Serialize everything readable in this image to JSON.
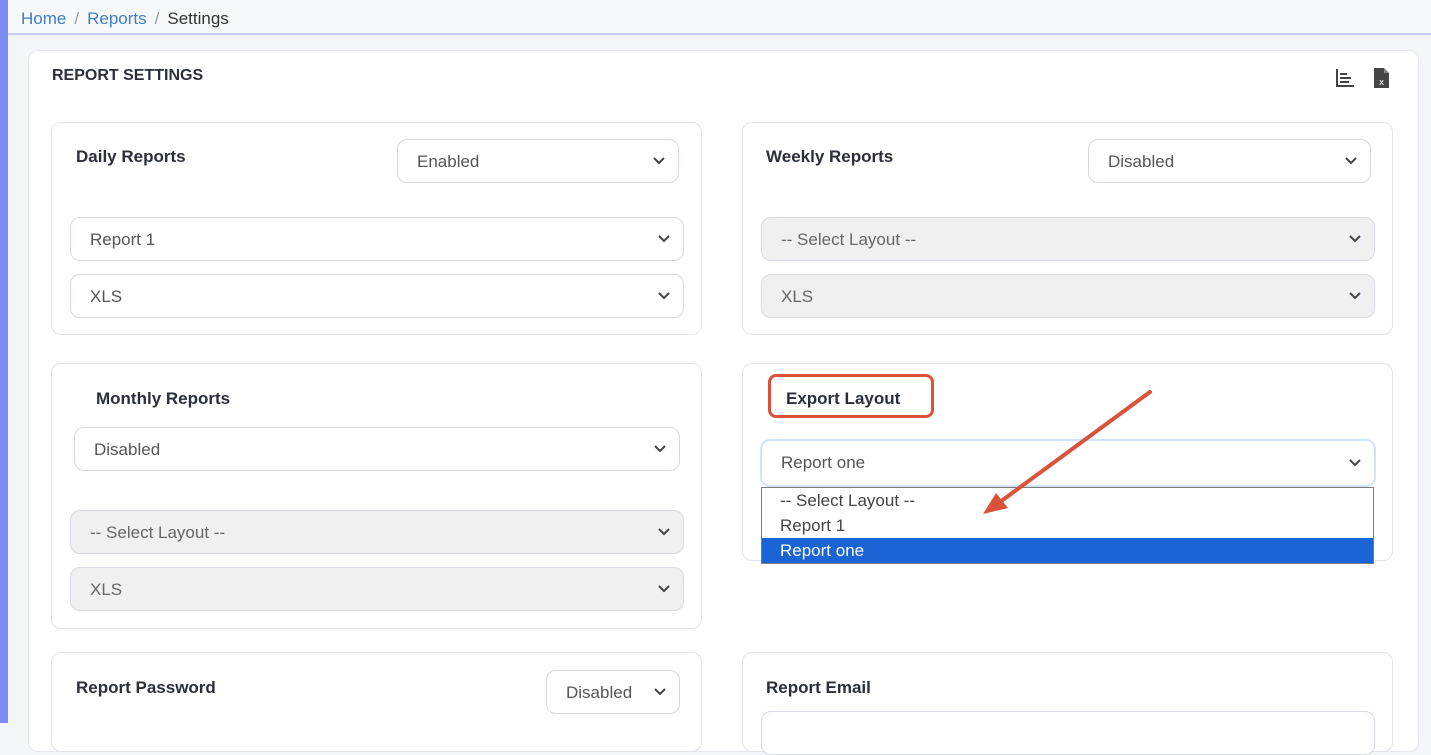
{
  "breadcrumb": {
    "home": "Home",
    "reports": "Reports",
    "current": "Settings"
  },
  "page": {
    "title": "REPORT SETTINGS"
  },
  "toolbar": {
    "chart_icon": "bar-chart-icon",
    "excel_icon": "excel-file-icon"
  },
  "daily": {
    "title": "Daily Reports",
    "status": "Enabled",
    "layout": "Report 1",
    "format": "XLS"
  },
  "weekly": {
    "title": "Weekly Reports",
    "status": "Disabled",
    "layout": "-- Select Layout --",
    "format": "XLS"
  },
  "monthly": {
    "title": "Monthly Reports",
    "status": "Disabled",
    "layout": "-- Select Layout --",
    "format": "XLS"
  },
  "export": {
    "title": "Export Layout",
    "value": "Report one",
    "options": [
      "-- Select Layout --",
      "Report 1",
      "Report one"
    ],
    "selected_index": 2
  },
  "password": {
    "title": "Report Password",
    "status": "Disabled"
  },
  "email": {
    "title": "Report Email"
  },
  "colors": {
    "annotation": "#d9533c",
    "selected_option": "#1a64d6",
    "link": "#3f7fc4"
  }
}
